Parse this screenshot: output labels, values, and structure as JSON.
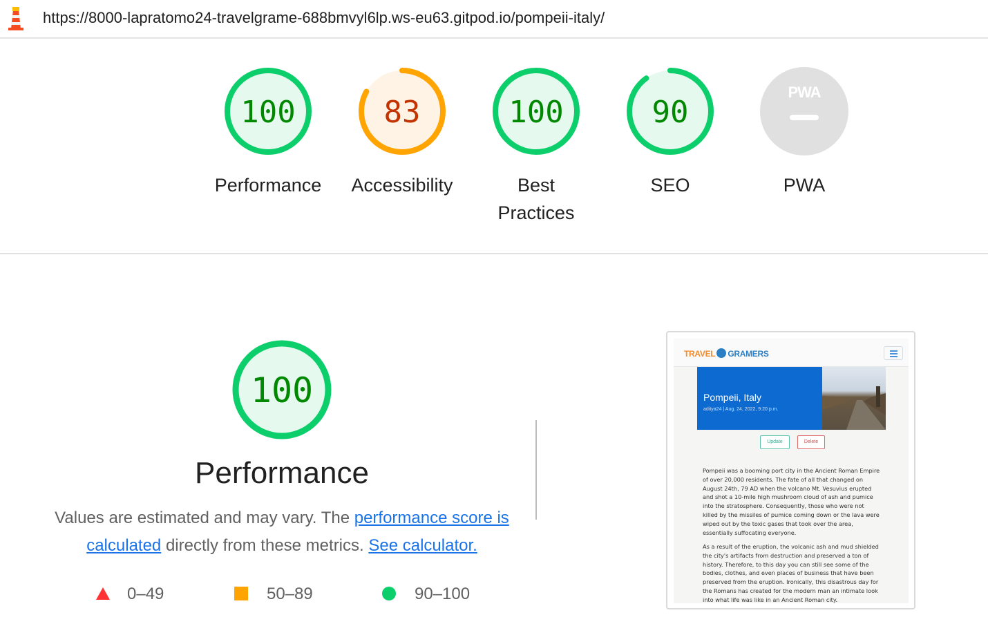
{
  "browser": {
    "url": "https://8000-lapratomo24-travelgrame-688bmvyl6lp.ws-eu63.gitpod.io/pompeii-italy/"
  },
  "summary": {
    "categories": [
      {
        "label": "Performance",
        "score": "100",
        "value": 100,
        "rating": "pass"
      },
      {
        "label": "Accessibility",
        "score": "83",
        "value": 83,
        "rating": "average"
      },
      {
        "label": "Best Practices",
        "score": "100",
        "value": 100,
        "rating": "pass"
      },
      {
        "label": "SEO",
        "score": "90",
        "value": 90,
        "rating": "pass"
      },
      {
        "label": "PWA",
        "score": "",
        "value": null,
        "rating": "na",
        "badge_text": "PWA"
      }
    ]
  },
  "performance": {
    "score": "100",
    "value": 100,
    "title": "Performance",
    "desc_prefix": "Values are estimated and may vary. The ",
    "desc_link1": "performance score is calculated",
    "desc_middle": " directly from these metrics. ",
    "desc_link2": "See calculator.",
    "legend": [
      {
        "range": "0–49",
        "shape": "triangle",
        "color": "#ff3333"
      },
      {
        "range": "50–89",
        "shape": "square",
        "color": "#ffa400"
      },
      {
        "range": "90–100",
        "shape": "circle",
        "color": "#0cce6b"
      }
    ]
  },
  "screenshot": {
    "brand_left": "TRAVEL",
    "brand_right": "GRAMERS",
    "hero_title": "Pompeii, Italy",
    "hero_meta": "aditya24 | Aug. 24, 2022, 9:20 p.m.",
    "update_label": "Update",
    "delete_label": "Delete",
    "para1": "Pompeii was a booming port city in the Ancient Roman Empire of over 20,000 residents. The fate of all that changed on August 24th, 79 AD when the volcano Mt. Vesuvius erupted and shot a 10-mile high mushroom cloud of ash and pumice into the stratosphere. Consequently, those who were not killed by the missiles of pumice coming down or the lava were wiped out by the toxic gases that took over the area, essentially suffocating everyone.",
    "para2": "As a result of the eruption, the volcanic ash and mud shielded the city's artifacts from destruction and preserved a ton of history. Therefore, to this day you can still see some of the bodies, clothes, and even places of business that have been preserved from the eruption. Ironically, this disastrous day for the Romans has created for the modern man an intimate look into what life was like in an Ancient Roman city."
  },
  "colors": {
    "pass": "#0cce6b",
    "pass_text": "#008800",
    "pass_fill": "#e6f9ee",
    "average": "#ffa400",
    "average_text": "#c33300",
    "average_fill": "#fff3e6",
    "na": "#e0e0e0",
    "link": "#1a73e8"
  }
}
